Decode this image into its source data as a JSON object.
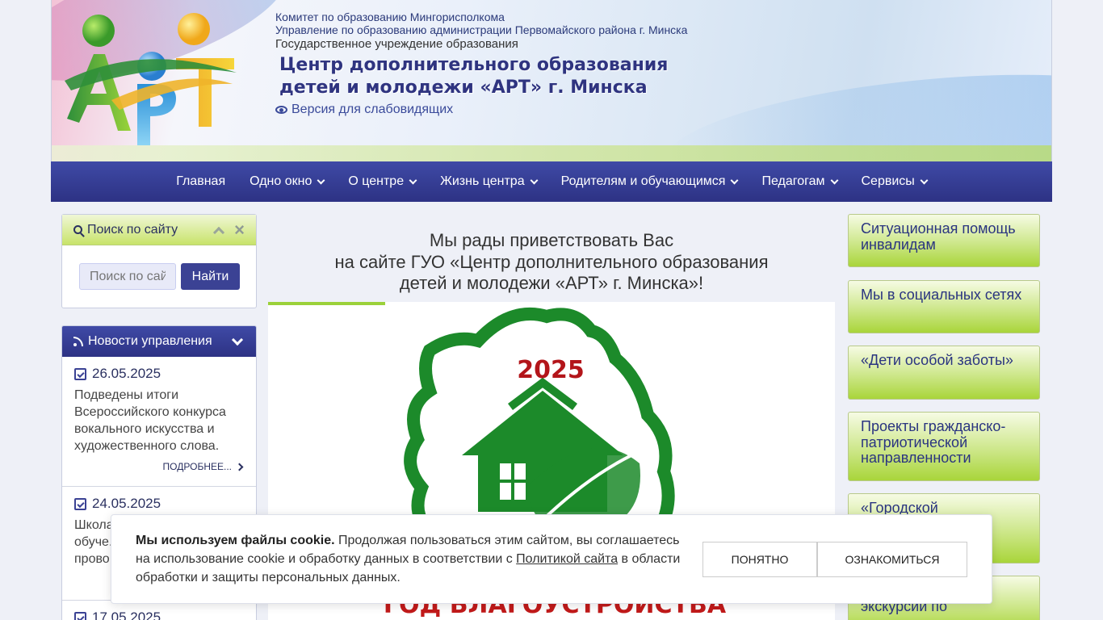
{
  "header": {
    "line1": "Комитет по образованию Мингорисполкома",
    "line2": "Управление по образованию администрации Первомайского района г. Минска",
    "line3": "Государственное учреждение образования",
    "title1": "Центр дополнительного образования",
    "title2": "детей и молодежи «АРТ» г. Минска",
    "vision_link": "Версия для слабовидящих"
  },
  "nav": {
    "items": [
      {
        "label": "Главная"
      },
      {
        "label": "Одно окно"
      },
      {
        "label": "О центре"
      },
      {
        "label": "Жизнь центра"
      },
      {
        "label": "Родителям и обучающимся"
      },
      {
        "label": "Педагогам"
      },
      {
        "label": "Сервисы"
      }
    ]
  },
  "search": {
    "title": "Поиск по сайту",
    "placeholder": "Поиск по сайту",
    "button": "Найти"
  },
  "news": {
    "title": "Новости управления",
    "items": [
      {
        "date": "26.05.2025",
        "text": "Подведены итоги Всероссийского конкурса вокального искусства и художественного слова.",
        "more": "ПОДРОБНЕЕ..."
      },
      {
        "date": "24.05.2025",
        "text": "Школа... обуче... прово...",
        "more": ""
      },
      {
        "date": "17.05.2025",
        "text": "",
        "more": ""
      }
    ]
  },
  "welcome": {
    "line1": "Мы рады приветствовать Вас",
    "line2": "на сайте ГУО «Центр дополнительного образования",
    "line3": "детей и молодежи «АРТ» г. Минска»!"
  },
  "banner": {
    "year": "2025",
    "caption": "ГОД БЛАГОУСТРОЙСТВА"
  },
  "right_links": [
    {
      "label": "Ситуационная помощь инвалидам"
    },
    {
      "label": "Мы в социальных сетях"
    },
    {
      "label": "«Дети особой заботы»"
    },
    {
      "label": "Проекты гражданско-патриотической направленности"
    },
    {
      "label": "«Городской"
    },
    {
      "label": "экскурсии по"
    }
  ],
  "cookie": {
    "bold": "Мы используем файлы cookie.",
    "text1": " Продолжая пользоваться этим сайтом, вы соглашаетесь на использование cookie и обработку данных в соответствии с ",
    "link": "Политикой сайта",
    "text2": " в области обработки и защиты персональных данных.",
    "accept": "ПОНЯТНО",
    "details": "ОЗНАКОМИТЬСЯ"
  },
  "colors": {
    "nav_bg": "#2d3284",
    "accent_green": "#9bd13a",
    "brand_text": "#2f3480"
  }
}
